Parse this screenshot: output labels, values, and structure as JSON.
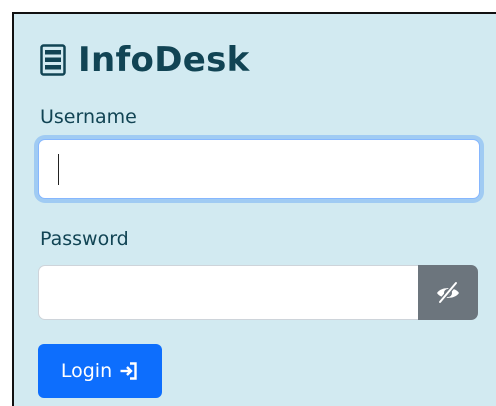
{
  "app": {
    "title": "InfoDesk",
    "icon": "server-icon"
  },
  "form": {
    "username_label": "Username",
    "username_value": "",
    "username_placeholder": "",
    "password_label": "Password",
    "password_value": "",
    "password_placeholder": "",
    "toggle_icon": "eye-slash-icon",
    "login_label": "Login",
    "login_icon": "box-arrow-in-right-icon"
  },
  "colors": {
    "panel_bg": "#d2eaf1",
    "heading": "#114454",
    "primary": "#0d6efd",
    "secondary": "#6c757d",
    "focus_border": "#86b7fe"
  }
}
